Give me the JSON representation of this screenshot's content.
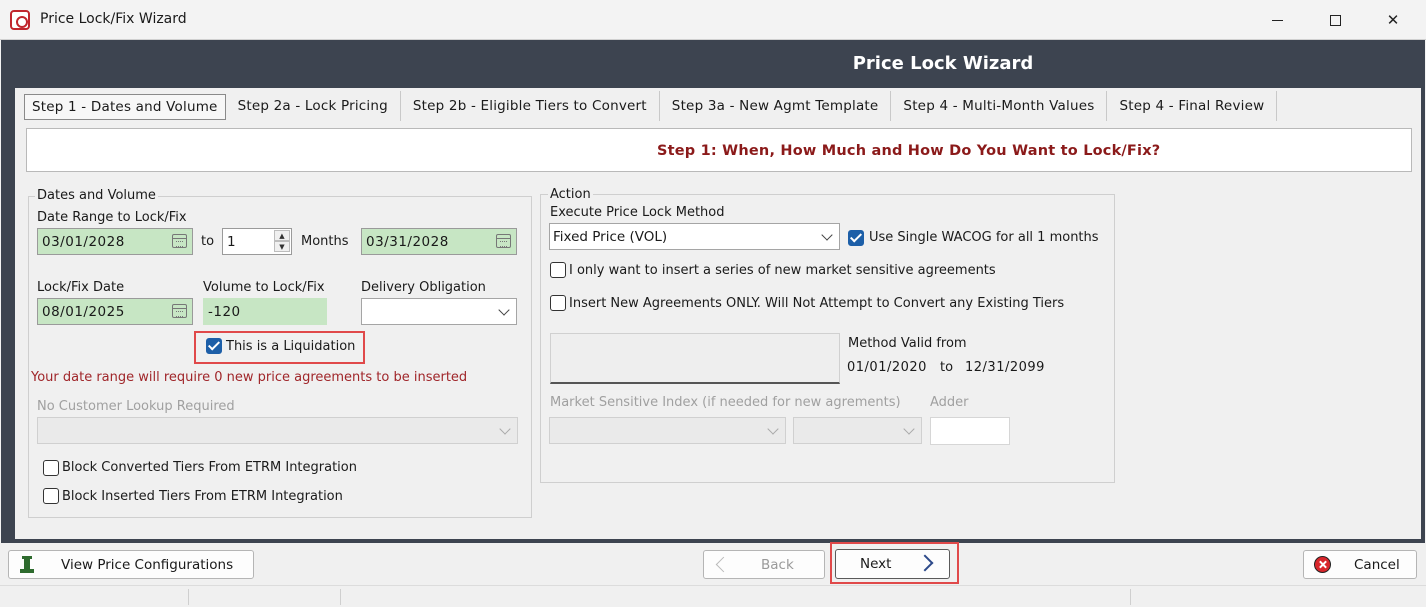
{
  "window": {
    "title": "Price Lock/Fix Wizard",
    "controls": {
      "minimize": "—",
      "maximize": "□",
      "close": "✕"
    }
  },
  "wizard": {
    "title": "Price Lock Wizard"
  },
  "tabs": [
    {
      "label": "Step 1 - Dates and Volume",
      "active": true
    },
    {
      "label": "Step 2a - Lock Pricing"
    },
    {
      "label": "Step 2b - Eligible Tiers to Convert"
    },
    {
      "label": "Step 3a - New Agmt Template"
    },
    {
      "label": "Step 4 - Multi-Month Values"
    },
    {
      "label": "Step 4 - Final Review"
    }
  ],
  "step_banner": "Step 1: When, How Much and How Do You Want to Lock/Fix?",
  "dates_volume": {
    "group_title": "Dates and Volume",
    "range_label": "Date Range to Lock/Fix",
    "start_date": "03/01/2028",
    "to_label": "to",
    "months_value": "1",
    "months_label": "Months",
    "end_date": "03/31/2028",
    "lockfix_date_label": "Lock/Fix Date",
    "lockfix_date": "08/01/2025",
    "volume_label": "Volume to Lock/Fix",
    "volume": "-120",
    "delivery_label": "Delivery Obligation",
    "delivery_value": "",
    "liquidation_label": "This is a Liquidation",
    "liquidation_checked": true,
    "warning": "Your date range will require 0 new price agreements to be inserted",
    "customer_label": "No Customer Lookup Required",
    "block_converted_label": "Block Converted Tiers From ETRM Integration",
    "block_inserted_label": "Block Inserted Tiers From ETRM Integration"
  },
  "action": {
    "group_title": "Action",
    "method_label": "Execute Price Lock Method",
    "method_value": "Fixed Price (VOL)",
    "single_wacog_label": "Use Single WACOG for all 1 months",
    "single_wacog_checked": true,
    "series_label": "I only want to insert a series of new market sensitive agreements",
    "insert_only_label": "Insert New Agreements ONLY. Will Not Attempt to Convert any Existing Tiers",
    "valid_from_label": "Method Valid from",
    "valid_from": "01/01/2020",
    "valid_to_label": "to",
    "valid_to": "12/31/2099",
    "market_index_label": "Market Sensitive Index (if needed for new agrements)",
    "adder_label": "Adder"
  },
  "buttons": {
    "view_configs": "View Price Configurations",
    "back": "Back",
    "next": "Next",
    "cancel": "Cancel"
  },
  "colors": {
    "frame": "#3d4450",
    "banner_text": "#8b1a1a",
    "highlight": "#e0494a",
    "field_green": "#c7e6c4",
    "checkbox_blue": "#1d5fa8"
  }
}
